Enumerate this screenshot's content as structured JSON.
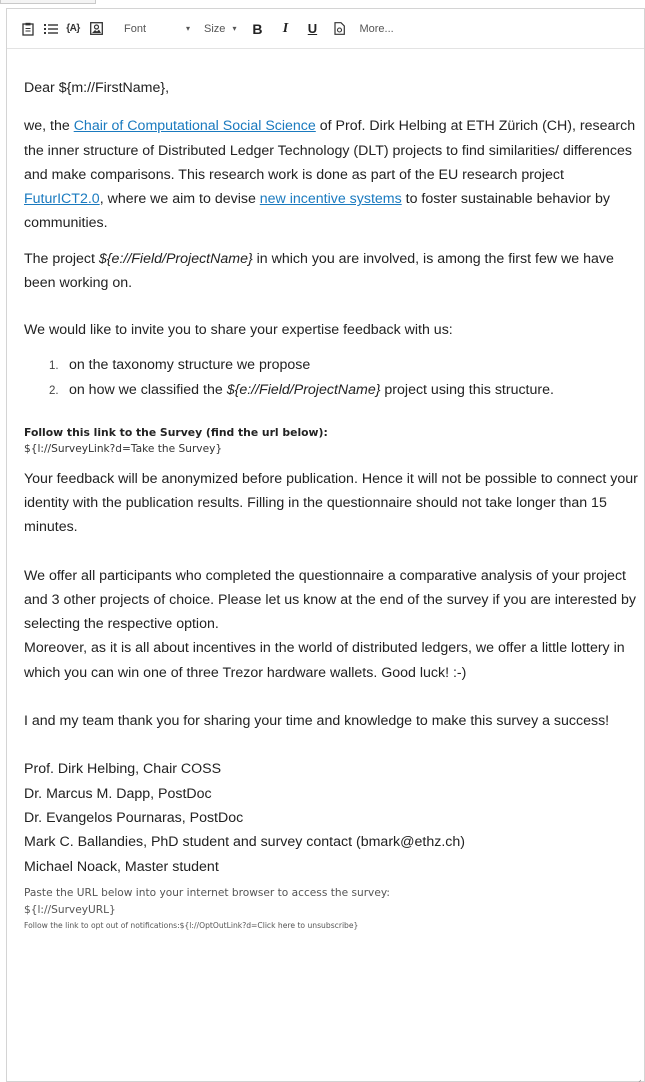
{
  "toolbar": {
    "items": [
      {
        "name": "paste-icon"
      },
      {
        "name": "bulleted-list-icon"
      },
      {
        "name": "piped-text-icon",
        "label": "{A}"
      },
      {
        "name": "insert-image-icon"
      }
    ],
    "font_label": "Font",
    "size_label": "Size",
    "bold_label": "B",
    "italic_label": "I",
    "underline_label": "U",
    "source_icon": "source-code-icon",
    "more_label": "More..."
  },
  "greeting": "Dear ${m://FirstName},",
  "intro": {
    "t1": "we, the ",
    "link1": "Chair of Computational Social Science",
    "t2": " of Prof. Dirk Helbing at ETH Zürich (CH), research the inner structure of Distributed Ledger Technology (DLT) projects to find similarities/ differences and make comparisons. This research work is done as part of the EU research project ",
    "link2": "FuturICT2.0",
    "t3": ", where we aim to devise ",
    "link3": "new incentive systems",
    "t4": " to foster sustainable behavior by communities."
  },
  "project_para": {
    "t1": "The project ",
    "field": "${e://Field/ProjectName}",
    "t2": " in which you are involved, is among the first few we have been working on."
  },
  "invite": "We would like to invite you to share your expertise feedback with us:",
  "steps": [
    {
      "num": "1.",
      "t1": "on the taxonomy structure we propose",
      "field": "",
      "t2": ""
    },
    {
      "num": "2.",
      "t1": "on how we classified the ",
      "field": "${e://Field/ProjectName}",
      "t2": " project using this structure."
    }
  ],
  "survey": {
    "heading": "Follow this link to the Survey (find the url below):",
    "link": "${l://SurveyLink?d=Take the Survey}"
  },
  "anon_para": "Your feedback will be anonymized before publication. Hence it will not be possible to connect your identity with the publication results. Filling in the questionnaire should not take longer than 15 minutes.",
  "offer_para": "We offer all participants who completed the questionnaire a comparative analysis of your project and 3 other projects of choice. Please let us know at the end of the survey if you are interested by selecting the respective option.",
  "lottery_para": "Moreover, as it is all about incentives in the world of distributed ledgers, we offer a little lottery in which you can win one of three Trezor hardware wallets. Good luck! :-)",
  "thanks_para": "I and my team thank you for sharing your time and knowledge to make this survey a success!",
  "signatures": [
    "Prof. Dirk Helbing, Chair COSS",
    "Dr. Marcus M. Dapp, PostDoc",
    "Dr. Evangelos Pournaras, PostDoc",
    "Mark C. Ballandies, PhD student and survey contact (bmark@ethz.ch)",
    "Michael Noack, Master student"
  ],
  "footer": {
    "paste_text": "Paste the URL below into your internet browser to access the survey:",
    "survey_url": "${l://SurveyURL}",
    "optout_text": "Follow the link to opt out of notifications:${l://OptOutLink?d=Click here to unsubscribe}"
  }
}
